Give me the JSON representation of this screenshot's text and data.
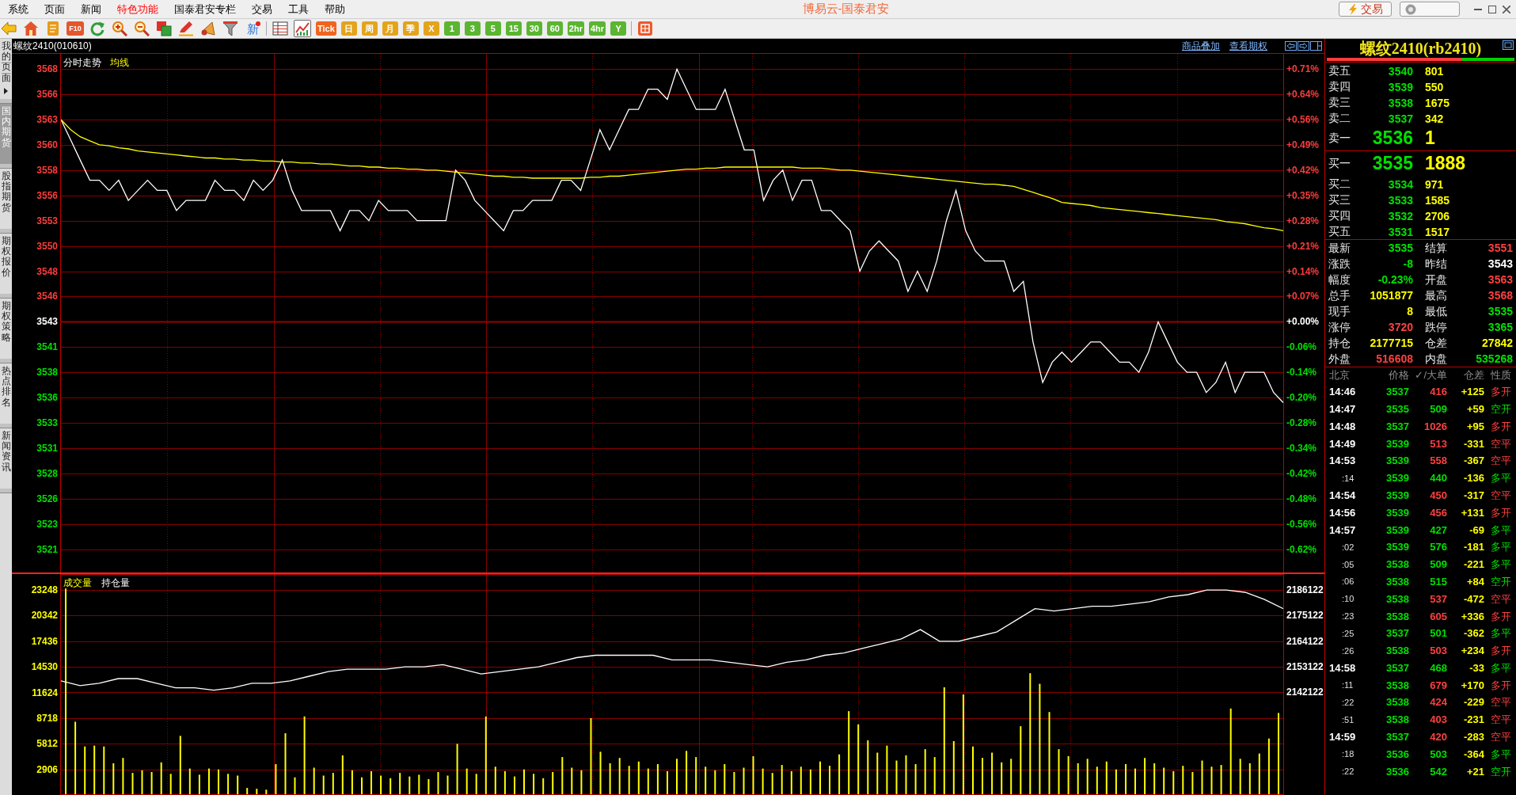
{
  "window": {
    "title": "博易云-国泰君安",
    "trade_button": "交易"
  },
  "menu": [
    {
      "label": "系统",
      "kind": "normal"
    },
    {
      "label": "页面",
      "kind": "normal"
    },
    {
      "label": "新闻",
      "kind": "normal"
    },
    {
      "label": "特色功能",
      "kind": "featured"
    },
    {
      "label": "国泰君安专栏",
      "kind": "normal"
    },
    {
      "label": "交易",
      "kind": "normal"
    },
    {
      "label": "工具",
      "kind": "normal"
    },
    {
      "label": "帮助",
      "kind": "normal"
    }
  ],
  "toolbar": {
    "f10_label": "F10",
    "news_label": "新",
    "views": [
      {
        "selected": false
      },
      {
        "selected": true
      }
    ],
    "periods": [
      {
        "label": "Tick",
        "color": "#ef6420",
        "selected": false
      },
      {
        "label": "日",
        "color": "#e3a41c",
        "selected": false
      },
      {
        "label": "周",
        "color": "#e3a41c",
        "selected": false
      },
      {
        "label": "月",
        "color": "#e3a41c",
        "selected": false
      },
      {
        "label": "季",
        "color": "#e3a41c",
        "selected": false
      },
      {
        "label": "X",
        "color": "#e3a41c",
        "selected": false
      },
      {
        "label": "1",
        "color": "#5bb531",
        "selected": false
      },
      {
        "label": "3",
        "color": "#5bb531",
        "selected": false
      },
      {
        "label": "5",
        "color": "#5bb531",
        "selected": false
      },
      {
        "label": "15",
        "color": "#5bb531",
        "selected": false
      },
      {
        "label": "30",
        "color": "#5bb531",
        "selected": false
      },
      {
        "label": "60",
        "color": "#5bb531",
        "selected": false
      },
      {
        "label": "2hr",
        "color": "#5bb531",
        "selected": false
      },
      {
        "label": "4hr",
        "color": "#5bb531",
        "selected": false
      },
      {
        "label": "Y",
        "color": "#5bb531",
        "selected": false
      }
    ]
  },
  "sidebar": {
    "tabs": [
      {
        "label": "我的页面",
        "kind": "menu",
        "selected": false
      },
      {
        "label": "国内期货",
        "kind": "page",
        "selected": true
      },
      {
        "label": "股指期货",
        "kind": "page",
        "selected": false
      },
      {
        "label": "期权报价",
        "kind": "page",
        "selected": false
      },
      {
        "label": "期权策略",
        "kind": "page",
        "selected": false
      },
      {
        "label": "热点排名",
        "kind": "page",
        "selected": false
      },
      {
        "label": "新闻资讯",
        "kind": "page",
        "selected": false
      }
    ]
  },
  "chart_header": {
    "title": "螺纹2410(010610)",
    "links": [
      "商品叠加",
      "查看期权"
    ]
  },
  "price_chart": {
    "chart_data": {
      "type": "line",
      "grid": true,
      "ylim": [
        3518.2,
        3569.5
      ],
      "yticks": [
        {
          "value": 3568,
          "label": "3568"
        },
        {
          "value": 3565.5,
          "label": "3566"
        },
        {
          "value": 3563,
          "label": "3563"
        },
        {
          "value": 3560.5,
          "label": "3560"
        },
        {
          "value": 3558,
          "label": "3558"
        },
        {
          "value": 3555.5,
          "label": "3556"
        },
        {
          "value": 3553,
          "label": "3553"
        },
        {
          "value": 3550.5,
          "label": "3550"
        },
        {
          "value": 3548,
          "label": "3548"
        },
        {
          "value": 3545.5,
          "label": "3546"
        },
        {
          "value": 3543,
          "label": "3543"
        },
        {
          "value": 3540.5,
          "label": "3541"
        },
        {
          "value": 3538,
          "label": "3538"
        },
        {
          "value": 3535.5,
          "label": "3536"
        },
        {
          "value": 3533,
          "label": "3533"
        },
        {
          "value": 3530.5,
          "label": "3531"
        },
        {
          "value": 3528,
          "label": "3528"
        },
        {
          "value": 3525.5,
          "label": "3526"
        },
        {
          "value": 3523,
          "label": "3523"
        },
        {
          "value": 3520.5,
          "label": "3521"
        }
      ],
      "series": [
        {
          "name": "分时走势",
          "color": "#ffffff",
          "values": [
            3563,
            3561,
            3559,
            3557,
            3557,
            3556,
            3557,
            3555,
            3556,
            3557,
            3556,
            3556,
            3554,
            3555,
            3555,
            3555,
            3557,
            3556,
            3556,
            3555,
            3557,
            3556,
            3557,
            3559,
            3556,
            3554,
            3554,
            3554,
            3554,
            3552,
            3554,
            3554,
            3553,
            3555,
            3554,
            3554,
            3554,
            3553,
            3553,
            3553,
            3553,
            3558,
            3557,
            3555,
            3554,
            3553,
            3552,
            3554,
            3554,
            3555,
            3555,
            3555,
            3557,
            3557,
            3556,
            3559,
            3562,
            3560,
            3562,
            3564,
            3564,
            3566,
            3566,
            3565,
            3568,
            3566,
            3564,
            3564,
            3564,
            3566,
            3563,
            3560,
            3560,
            3555,
            3557,
            3558,
            3555,
            3557,
            3557,
            3554,
            3554,
            3553,
            3552,
            3548,
            3550,
            3551,
            3550,
            3549,
            3546,
            3548,
            3546,
            3549,
            3553,
            3556,
            3552,
            3550,
            3549,
            3549,
            3549,
            3546,
            3547,
            3541,
            3537,
            3539,
            3540,
            3539,
            3540,
            3541,
            3541,
            3540,
            3539,
            3539,
            3538,
            3540,
            3543,
            3541,
            3539,
            3538,
            3538,
            3536,
            3537,
            3539,
            3536,
            3538,
            3538,
            3538,
            3536,
            3535
          ]
        },
        {
          "name": "均线",
          "color": "#ffff00",
          "values": [
            3563.0,
            3562.0,
            3561.3,
            3560.9,
            3560.5,
            3560.4,
            3560.2,
            3560.1,
            3559.9,
            3559.8,
            3559.7,
            3559.6,
            3559.5,
            3559.4,
            3559.3,
            3559.2,
            3559.2,
            3559.1,
            3559.1,
            3559.0,
            3559.0,
            3558.9,
            3558.9,
            3558.8,
            3558.8,
            3558.7,
            3558.7,
            3558.6,
            3558.6,
            3558.5,
            3558.4,
            3558.4,
            3558.3,
            3558.3,
            3558.2,
            3558.2,
            3558.1,
            3558.1,
            3558.0,
            3558.0,
            3557.9,
            3557.8,
            3557.7,
            3557.6,
            3557.5,
            3557.4,
            3557.4,
            3557.3,
            3557.3,
            3557.2,
            3557.2,
            3557.2,
            3557.2,
            3557.2,
            3557.2,
            3557.3,
            3557.3,
            3557.4,
            3557.4,
            3557.5,
            3557.6,
            3557.7,
            3557.8,
            3557.9,
            3558.0,
            3558.1,
            3558.1,
            3558.2,
            3558.2,
            3558.3,
            3558.3,
            3558.3,
            3558.3,
            3558.3,
            3558.3,
            3558.3,
            3558.3,
            3558.2,
            3558.2,
            3558.2,
            3558.1,
            3558.0,
            3558.0,
            3557.9,
            3557.8,
            3557.7,
            3557.6,
            3557.5,
            3557.4,
            3557.3,
            3557.2,
            3557.1,
            3557.0,
            3556.9,
            3556.8,
            3556.7,
            3556.6,
            3556.6,
            3556.5,
            3556.4,
            3556.1,
            3555.8,
            3555.5,
            3555.2,
            3554.8,
            3554.7,
            3554.6,
            3554.5,
            3554.3,
            3554.2,
            3554.1,
            3554.0,
            3553.9,
            3553.8,
            3553.7,
            3553.6,
            3553.5,
            3553.4,
            3553.3,
            3553.2,
            3553.1,
            3552.9,
            3552.8,
            3552.7,
            3552.5,
            3552.3,
            3552.2,
            3552.0
          ]
        }
      ],
      "ref_lines": [
        {
          "axis": "y",
          "value": 3543
        }
      ]
    },
    "right_axis_labels": [
      "+0.71%",
      "+0.64%",
      "+0.56%",
      "+0.49%",
      "+0.42%",
      "+0.35%",
      "+0.28%",
      "+0.21%",
      "+0.14%",
      "+0.07%",
      "+0.00%",
      "-0.06%",
      "-0.14%",
      "-0.20%",
      "-0.28%",
      "-0.34%",
      "-0.42%",
      "-0.48%",
      "-0.56%",
      "-0.62%"
    ]
  },
  "volume_chart": {
    "chart_data": {
      "type": "bar",
      "grid": true,
      "ylim": [
        0,
        25036
      ],
      "yticks": [
        23248,
        20342,
        17436,
        14530,
        11624,
        8718,
        5812,
        2906
      ],
      "series": [
        {
          "name": "成交量",
          "color": "#ffff00",
          "values": [
            23400,
            8300,
            5500,
            5600,
            5500,
            3600,
            4200,
            2500,
            2800,
            2600,
            3700,
            2400,
            6700,
            3000,
            2300,
            3000,
            2900,
            2400,
            2200,
            800,
            700,
            600,
            3500,
            7000,
            2000,
            8900,
            3100,
            2200,
            2500,
            4500,
            2800,
            2000,
            2700,
            2200,
            1900,
            2500,
            2100,
            2300,
            1800,
            2600,
            2200,
            5800,
            3000,
            2400,
            8900,
            3200,
            2700,
            2100,
            2900,
            2400,
            1900,
            2600,
            4300,
            3100,
            2800,
            8700,
            4900,
            3600,
            4200,
            3300,
            3800,
            3000,
            3500,
            2700,
            4100,
            5000,
            4300,
            3200,
            2800,
            3500,
            2600,
            3100,
            4400,
            3000,
            2500,
            3400,
            2700,
            3200,
            2900,
            3800,
            3300,
            4600,
            9500,
            8000,
            6200,
            4800,
            5600,
            3900,
            4500,
            3500,
            5200,
            4300,
            12200,
            6100,
            11400,
            5500,
            4200,
            4800,
            3700,
            4100,
            7800,
            13800,
            12600,
            9400,
            5200,
            4400,
            3600,
            4100,
            3200,
            3800,
            2900,
            3500,
            3000,
            4200,
            3600,
            3100,
            2700,
            3300,
            2600,
            3900,
            3200,
            3400,
            9800,
            4100,
            3600,
            4700,
            6400,
            9300
          ]
        }
      ]
    }
  },
  "open_interest_chart": {
    "chart_data": {
      "type": "line",
      "categories": [
        null,
        null,
        null,
        null,
        null,
        null,
        null,
        null,
        null,
        null,
        null,
        null,
        null,
        null,
        null,
        null,
        null,
        null,
        null,
        null,
        null,
        null,
        null,
        null,
        null,
        null,
        null,
        null,
        null,
        null,
        null,
        null,
        null,
        null,
        null,
        null,
        null,
        null,
        null,
        null,
        null,
        null,
        null,
        null,
        null,
        null,
        null,
        null,
        null,
        null,
        null,
        null,
        null,
        null,
        null,
        null,
        null,
        null,
        null,
        null,
        null,
        null,
        null,
        null,
        null
      ],
      "ylim": [
        2098056,
        2192823
      ],
      "yticks": [
        2186122,
        2175122,
        2164122,
        2153122,
        2142122
      ],
      "series": [
        {
          "name": "持仓量",
          "color": "#ffffff",
          "values": [
            2147000,
            2145000,
            2146000,
            2148000,
            2148000,
            2146000,
            2144000,
            2144000,
            2143000,
            2144000,
            2146000,
            2146000,
            2147000,
            2149000,
            2151000,
            2152000,
            2152000,
            2152000,
            2153000,
            2153000,
            2154000,
            2152000,
            2150000,
            2151000,
            2152000,
            2153000,
            2155000,
            2157000,
            2158000,
            2158000,
            2158000,
            2158000,
            2156000,
            2156000,
            2156000,
            2155000,
            2154000,
            2153000,
            2155000,
            2156000,
            2158000,
            2159000,
            2161000,
            2163000,
            2165000,
            2169000,
            2164000,
            2164000,
            2166000,
            2168000,
            2173000,
            2178000,
            2177000,
            2178000,
            2179000,
            2179000,
            2180000,
            2181000,
            2183000,
            2184000,
            2186000,
            2186000,
            2185000,
            2182000,
            2178000
          ]
        }
      ]
    }
  },
  "quote": {
    "title": "螺纹2410(rb2410)",
    "ratio_bar": {
      "level": 0.72
    },
    "asks": [
      {
        "label": "卖五",
        "price": "3540",
        "volume": "801",
        "kind": "level"
      },
      {
        "label": "卖四",
        "price": "3539",
        "volume": "550",
        "kind": "level"
      },
      {
        "label": "卖三",
        "price": "3538",
        "volume": "1675",
        "kind": "level"
      },
      {
        "label": "卖二",
        "price": "3537",
        "volume": "342",
        "kind": "level"
      },
      {
        "label": "卖一",
        "price": "3536",
        "volume": "1",
        "kind": "best"
      }
    ],
    "bids": [
      {
        "label": "买一",
        "price": "3535",
        "volume": "1888",
        "kind": "best"
      },
      {
        "label": "买二",
        "price": "3534",
        "volume": "971",
        "kind": "level"
      },
      {
        "label": "买三",
        "price": "3533",
        "volume": "1585",
        "kind": "level"
      },
      {
        "label": "买四",
        "price": "3532",
        "volume": "2706",
        "kind": "level"
      },
      {
        "label": "买五",
        "price": "3531",
        "volume": "1517",
        "kind": "level"
      }
    ],
    "stats": [
      {
        "label": "最新",
        "value": "3535",
        "color": "#00e000"
      },
      {
        "label": "结算",
        "value": "3551",
        "color": "#ff4040"
      },
      {
        "label": "涨跌",
        "value": "-8",
        "color": "#00e000"
      },
      {
        "label": "昨结",
        "value": "3543",
        "color": "#ffffff"
      },
      {
        "label": "幅度",
        "value": "-0.23%",
        "color": "#00e000"
      },
      {
        "label": "开盘",
        "value": "3563",
        "color": "#ff4040"
      },
      {
        "label": "总手",
        "value": "1051877",
        "color": "#ffff00"
      },
      {
        "label": "最高",
        "value": "3568",
        "color": "#ff4040"
      },
      {
        "label": "现手",
        "value": "8",
        "color": "#ffff00"
      },
      {
        "label": "最低",
        "value": "3535",
        "color": "#00e000"
      },
      {
        "label": "涨停",
        "value": "3720",
        "color": "#ff4040"
      },
      {
        "label": "跌停",
        "value": "3365",
        "color": "#00e000"
      },
      {
        "label": "持仓",
        "value": "2177715",
        "color": "#ffff00"
      },
      {
        "label": "仓差",
        "value": "27842",
        "color": "#ffff00"
      },
      {
        "label": "外盘",
        "value": "516608",
        "color": "#ff4040"
      },
      {
        "label": "内盘",
        "value": "535268",
        "color": "#00e000"
      }
    ],
    "ticks": {
      "columns": [
        "北京",
        "价格",
        "✓/大单",
        "仓差",
        "性质"
      ],
      "rows": [
        {
          "kind": "minute",
          "time": "14:46",
          "price": "3537",
          "volume": "416",
          "oi_change": "+125",
          "nature": "多开",
          "color": "#ff4040"
        },
        {
          "kind": "minute",
          "time": "14:47",
          "price": "3535",
          "volume": "509",
          "oi_change": "+59",
          "nature": "空开",
          "color": "#00e000"
        },
        {
          "kind": "minute",
          "time": "14:48",
          "price": "3537",
          "volume": "1026",
          "oi_change": "+95",
          "nature": "多开",
          "color": "#ff4040"
        },
        {
          "kind": "minute",
          "time": "14:49",
          "price": "3539",
          "volume": "513",
          "oi_change": "-331",
          "nature": "空平",
          "color": "#ff4040"
        },
        {
          "kind": "minute",
          "time": "14:53",
          "price": "3539",
          "volume": "558",
          "oi_change": "-367",
          "nature": "空平",
          "color": "#ff4040"
        },
        {
          "kind": "second",
          "time": ":14",
          "price": "3539",
          "volume": "440",
          "oi_change": "-136",
          "nature": "多平",
          "color": "#00e000"
        },
        {
          "kind": "minute",
          "time": "14:54",
          "price": "3539",
          "volume": "450",
          "oi_change": "-317",
          "nature": "空平",
          "color": "#ff4040"
        },
        {
          "kind": "minute",
          "time": "14:56",
          "price": "3539",
          "volume": "456",
          "oi_change": "+131",
          "nature": "多开",
          "color": "#ff4040"
        },
        {
          "kind": "minute",
          "time": "14:57",
          "price": "3539",
          "volume": "427",
          "oi_change": "-69",
          "nature": "多平",
          "color": "#00e000"
        },
        {
          "kind": "second",
          "time": ":02",
          "price": "3539",
          "volume": "576",
          "oi_change": "-181",
          "nature": "多平",
          "color": "#00e000"
        },
        {
          "kind": "second",
          "time": ":05",
          "price": "3538",
          "volume": "509",
          "oi_change": "-221",
          "nature": "多平",
          "color": "#00e000"
        },
        {
          "kind": "second",
          "time": ":06",
          "price": "3538",
          "volume": "515",
          "oi_change": "+84",
          "nature": "空开",
          "color": "#00e000"
        },
        {
          "kind": "second",
          "time": ":10",
          "price": "3538",
          "volume": "537",
          "oi_change": "-472",
          "nature": "空平",
          "color": "#ff4040"
        },
        {
          "kind": "second",
          "time": ":23",
          "price": "3538",
          "volume": "605",
          "oi_change": "+336",
          "nature": "多开",
          "color": "#ff4040"
        },
        {
          "kind": "second",
          "time": ":25",
          "price": "3537",
          "volume": "501",
          "oi_change": "-362",
          "nature": "多平",
          "color": "#00e000"
        },
        {
          "kind": "second",
          "time": ":26",
          "price": "3538",
          "volume": "503",
          "oi_change": "+234",
          "nature": "多开",
          "color": "#ff4040"
        },
        {
          "kind": "minute",
          "time": "14:58",
          "price": "3537",
          "volume": "468",
          "oi_change": "-33",
          "nature": "多平",
          "color": "#00e000"
        },
        {
          "kind": "second",
          "time": ":11",
          "price": "3538",
          "volume": "679",
          "oi_change": "+170",
          "nature": "多开",
          "color": "#ff4040"
        },
        {
          "kind": "second",
          "time": ":22",
          "price": "3538",
          "volume": "424",
          "oi_change": "-229",
          "nature": "空平",
          "color": "#ff4040"
        },
        {
          "kind": "second",
          "time": ":51",
          "price": "3538",
          "volume": "403",
          "oi_change": "-231",
          "nature": "空平",
          "color": "#ff4040"
        },
        {
          "kind": "minute",
          "time": "14:59",
          "price": "3537",
          "volume": "420",
          "oi_change": "-283",
          "nature": "空平",
          "color": "#ff4040"
        },
        {
          "kind": "second",
          "time": ":18",
          "price": "3536",
          "volume": "503",
          "oi_change": "-364",
          "nature": "多平",
          "color": "#00e000"
        },
        {
          "kind": "second",
          "time": ":22",
          "price": "3536",
          "volume": "542",
          "oi_change": "+21",
          "nature": "空开",
          "color": "#00e000"
        }
      ]
    }
  }
}
